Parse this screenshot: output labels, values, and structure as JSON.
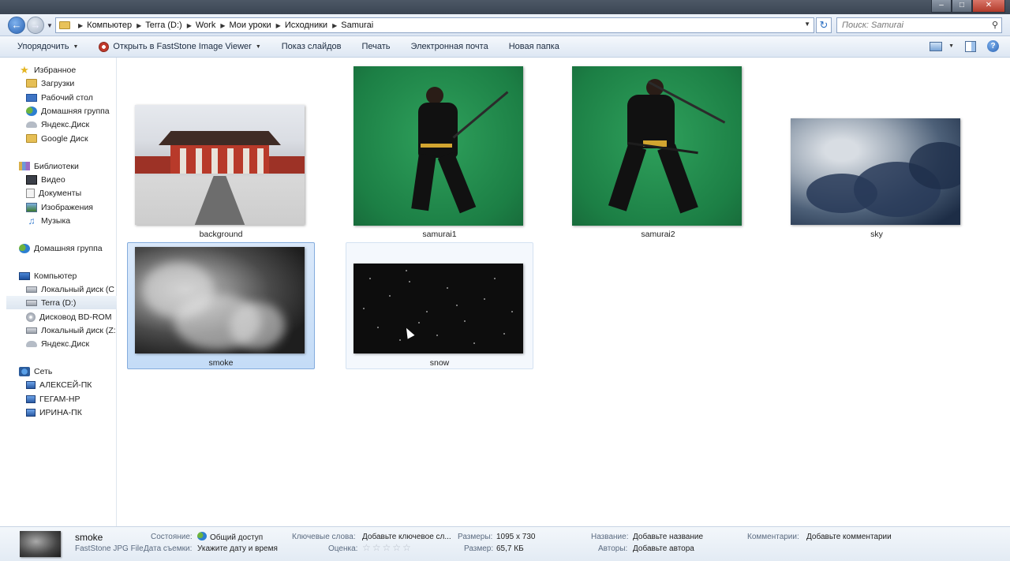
{
  "window": {
    "minimize": "–",
    "maximize": "□",
    "close": "✕"
  },
  "address": {
    "crumbs": [
      "Компьютер",
      "Terra (D:)",
      "Work",
      "Мои уроки",
      "Исходники",
      "Samurai"
    ],
    "search_placeholder": "Поиск: Samurai"
  },
  "toolbar": {
    "organize": "Упорядочить",
    "open_with": "Открыть в FastStone Image Viewer",
    "slideshow": "Показ слайдов",
    "print": "Печать",
    "email": "Электронная почта",
    "new_folder": "Новая папка"
  },
  "nav": {
    "favorites": {
      "header": "Избранное",
      "items": [
        "Загрузки",
        "Рабочий стол",
        "Домашняя группа",
        "Яндекс.Диск",
        "Google Диск"
      ]
    },
    "libraries": {
      "header": "Библиотеки",
      "items": [
        "Видео",
        "Документы",
        "Изображения",
        "Музыка"
      ]
    },
    "homegroup": "Домашняя группа",
    "computer": {
      "header": "Компьютер",
      "items": [
        "Локальный диск (C",
        "Terra (D:)",
        "Дисковод BD-ROM",
        "Локальный диск (Z:",
        "Яндекс.Диск"
      ]
    },
    "network": {
      "header": "Сеть",
      "items": [
        "АЛЕКСЕЙ-ПК",
        "ГЕГАМ-HP",
        "ИРИНА-ПК"
      ]
    }
  },
  "files": [
    {
      "name": "background"
    },
    {
      "name": "samurai1"
    },
    {
      "name": "samurai2"
    },
    {
      "name": "sky"
    },
    {
      "name": "smoke"
    },
    {
      "name": "snow"
    }
  ],
  "details": {
    "name": "smoke",
    "type": "FastStone JPG File",
    "state_label": "Состояние:",
    "state_value": "Общий доступ",
    "date_label": "Дата съемки:",
    "date_value": "Укажите дату и время",
    "keywords_label": "Ключевые слова:",
    "keywords_value": "Добавьте ключевое сл...",
    "rating_label": "Оценка:",
    "rating_value": "☆☆☆☆☆",
    "dims_label": "Размеры:",
    "dims_value": "1095 x 730",
    "size_label": "Размер:",
    "size_value": "65,7 КБ",
    "title_label": "Название:",
    "title_value": "Добавьте название",
    "authors_label": "Авторы:",
    "authors_value": "Добавьте автора",
    "comments_label": "Комментарии:",
    "comments_value": "Добавьте комментарии"
  }
}
